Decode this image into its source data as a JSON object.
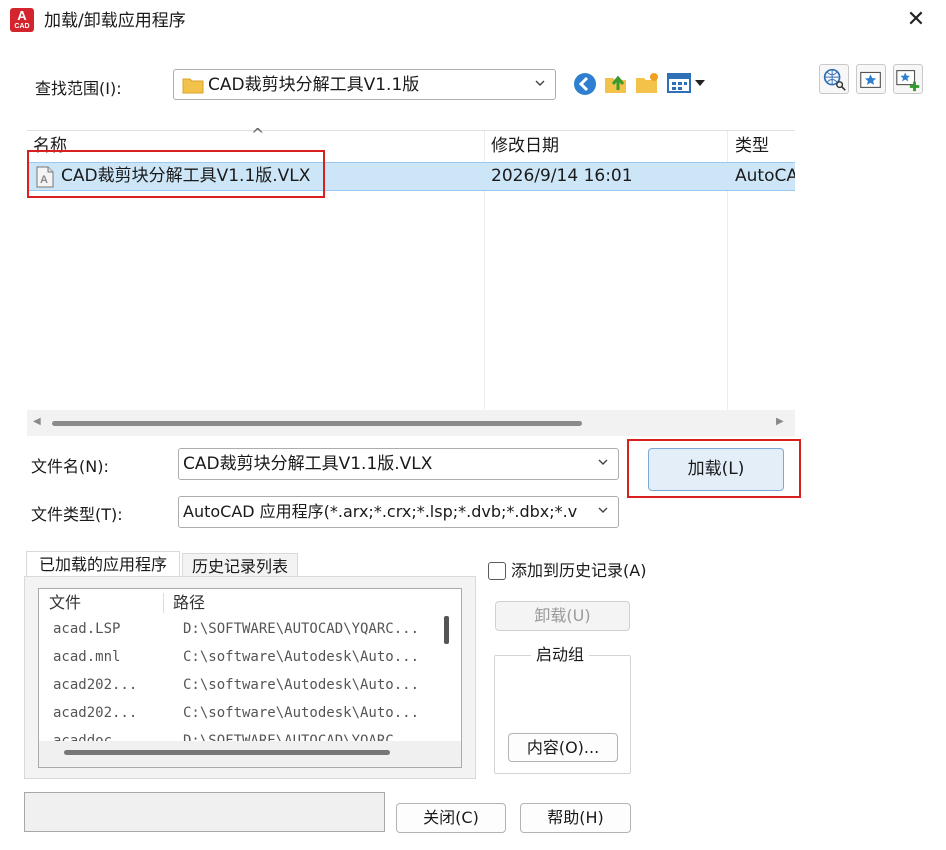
{
  "window": {
    "title": "加载/卸载应用程序",
    "icon_label": "A",
    "icon_sublabel": "CAD",
    "close_glyph": "✕"
  },
  "search_range": {
    "label": "查找范围(I):",
    "value": "CAD裁剪块分解工具V1.1版"
  },
  "file_list": {
    "columns": [
      "名称",
      "修改日期",
      "类型"
    ],
    "sort_glyph": "^",
    "rows": [
      {
        "name": "CAD裁剪块分解工具V1.1版.VLX",
        "modified": "2026/9/14 16:01",
        "type": "AutoCAD"
      }
    ]
  },
  "file_name": {
    "label": "文件名(N):",
    "value": "CAD裁剪块分解工具V1.1版.VLX"
  },
  "file_type": {
    "label": "文件类型(T):",
    "value": "AutoCAD 应用程序(*.arx;*.crx;*.lsp;*.dvb;*.dbx;*.v"
  },
  "load_button": "加载(L)",
  "tabs": [
    "已加载的应用程序",
    "历史记录列表"
  ],
  "loaded_apps": {
    "columns": [
      "文件",
      "路径"
    ],
    "rows": [
      {
        "file": "acad.LSP",
        "path": "D:\\SOFTWARE\\AUTOCAD\\YQARC..."
      },
      {
        "file": "acad.mnl",
        "path": "C:\\software\\Autodesk\\Auto..."
      },
      {
        "file": "acad202...",
        "path": "C:\\software\\Autodesk\\Auto..."
      },
      {
        "file": "acad202...",
        "path": "C:\\software\\Autodesk\\Auto..."
      },
      {
        "file": "acaddoc...",
        "path": "D:\\SOFTWARE\\AUTOCAD\\YQARC..."
      }
    ]
  },
  "add_history": "添加到历史记录(A)",
  "unload_button": "卸载(U)",
  "startup_group": {
    "label": "启动组",
    "contents_button": "内容(O)..."
  },
  "close_button": "关闭(C)",
  "help_button": "帮助(H)",
  "colors": {
    "highlight_red": "#d9201f",
    "selection_blue": "#cde6f7",
    "primary_button": "#e3eef9"
  }
}
